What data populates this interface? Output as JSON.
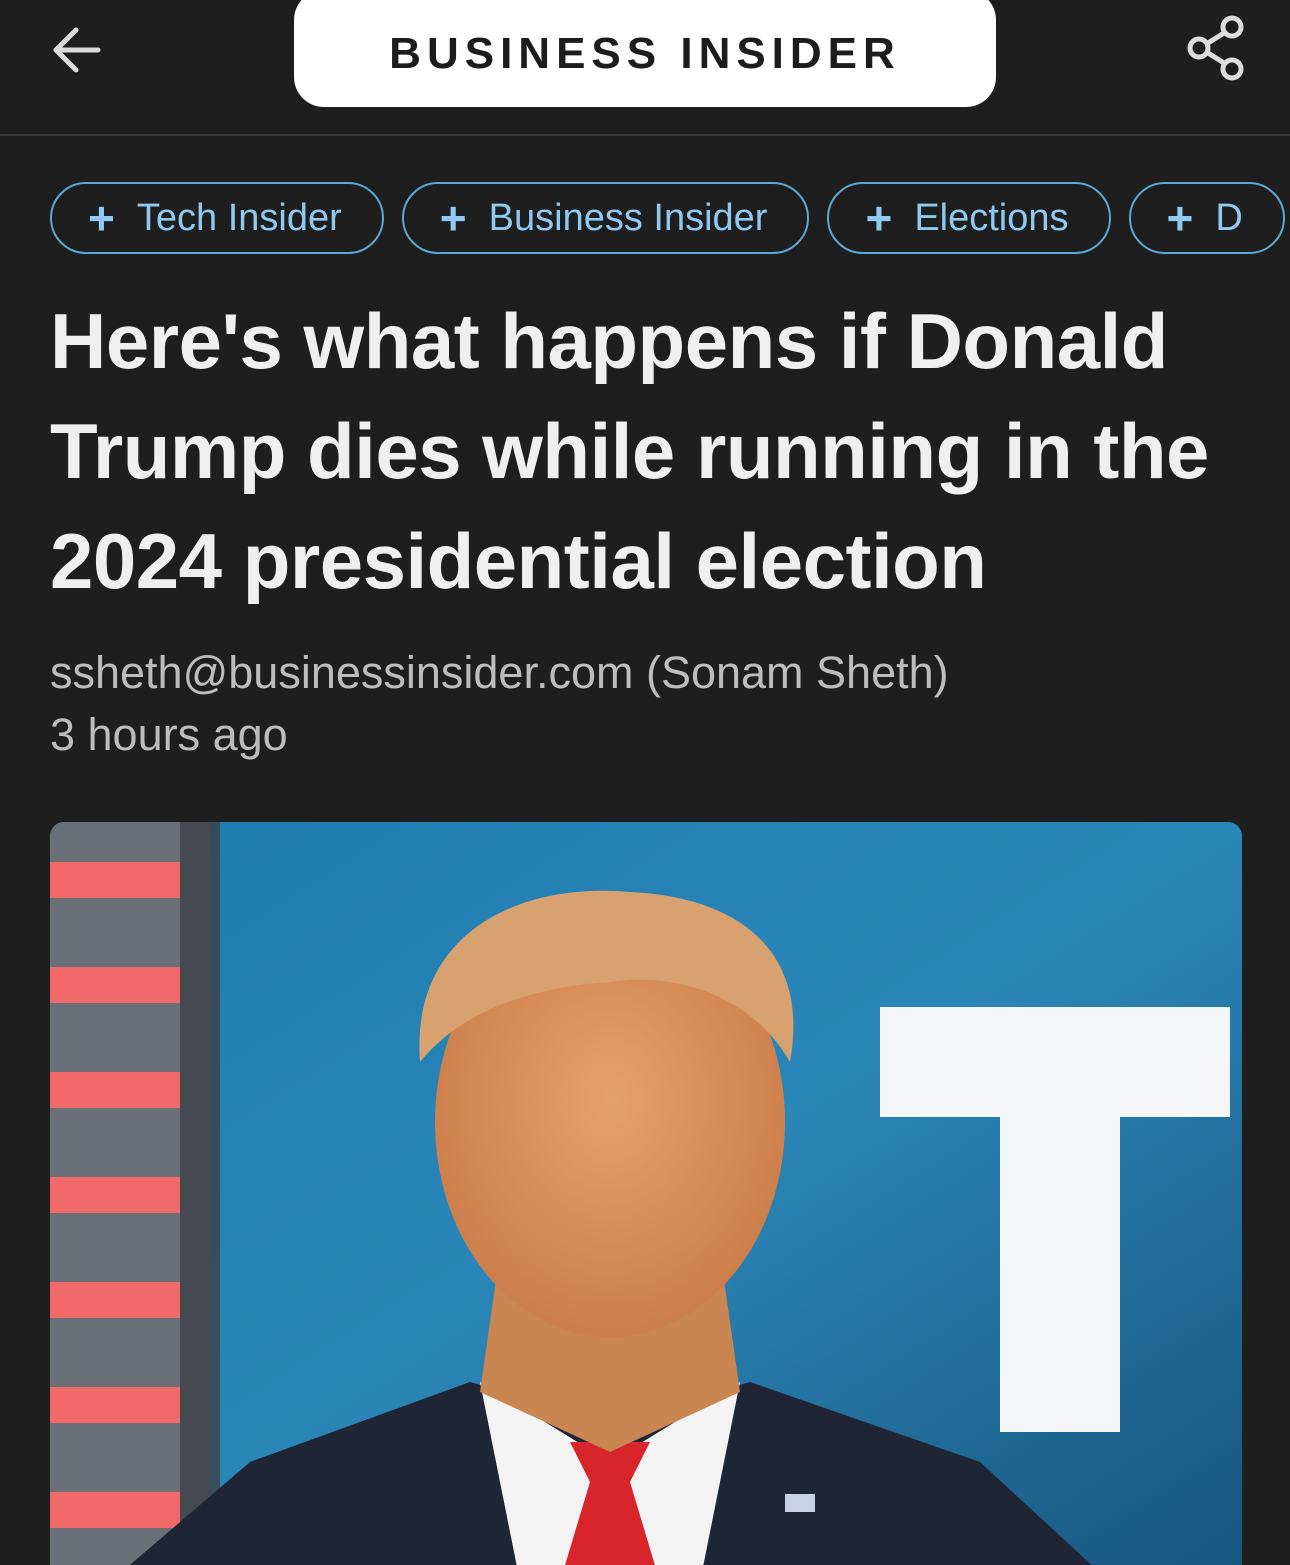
{
  "header": {
    "brand": "BUSINESS INSIDER",
    "back_icon": "arrow-left-icon",
    "share_icon": "share-icon"
  },
  "chips": [
    {
      "label": "Tech Insider",
      "icon": "plus-icon"
    },
    {
      "label": "Business Insider",
      "icon": "plus-icon"
    },
    {
      "label": "Elections",
      "icon": "plus-icon"
    },
    {
      "label": "D",
      "icon": "plus-icon"
    }
  ],
  "article": {
    "headline": "Here's what happens if Donald Trump dies while running in the 2024 presidential election",
    "author": "ssheth@businessinsider.com (Sonam Sheth)",
    "time": "3 hours ago"
  },
  "colors": {
    "background": "#1e1e1f",
    "chip_accent": "#5aa9d6",
    "brand_pill": "#ffffff"
  }
}
